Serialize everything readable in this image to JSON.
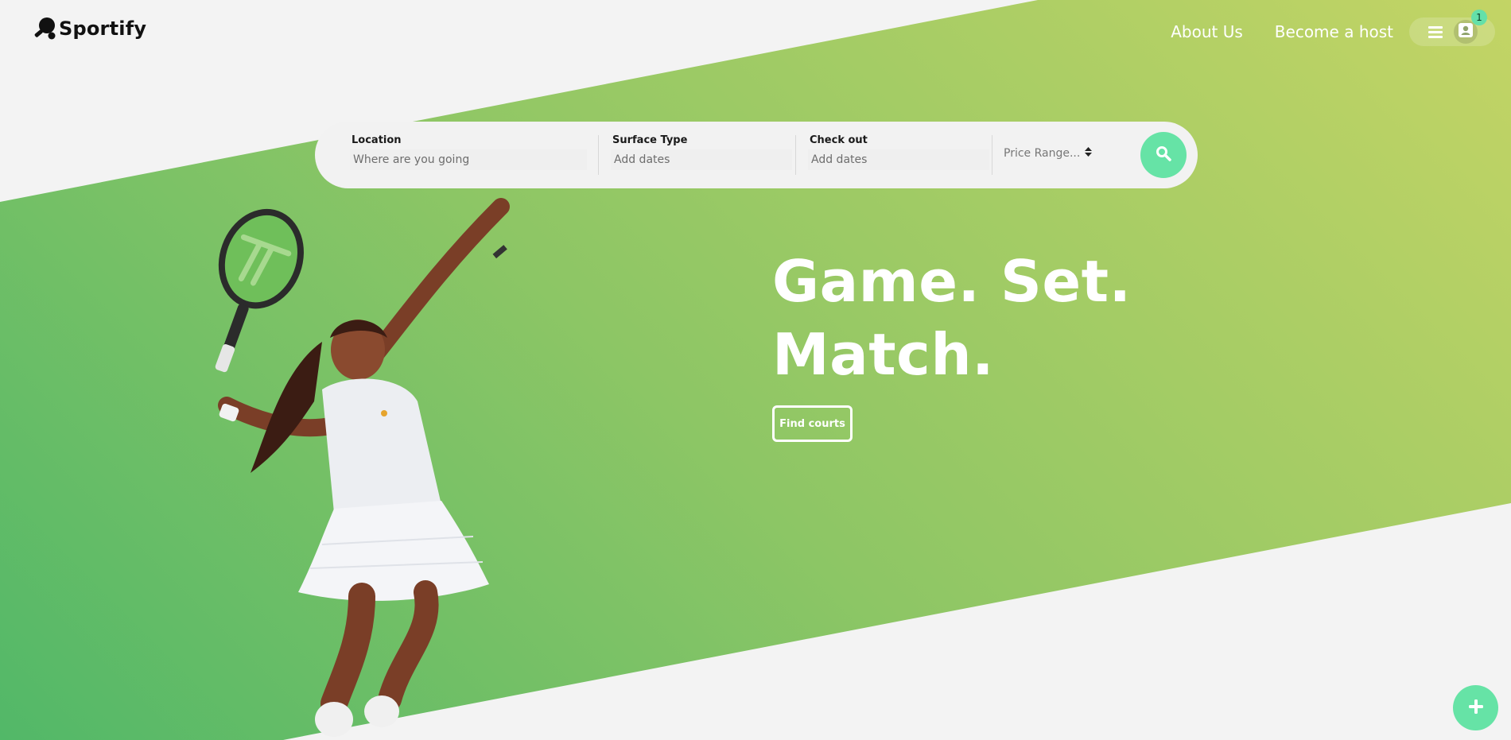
{
  "app": {
    "brand": "Sportify",
    "logo_icon": "ping-pong-paddle-icon"
  },
  "header": {
    "nav": {
      "about": "About Us",
      "host": "Become a host"
    },
    "user_menu": {
      "menu_icon": "hamburger-menu-icon",
      "avatar_icon": "user-contact-icon",
      "notification_count": "1"
    }
  },
  "search": {
    "location": {
      "label": "Location",
      "placeholder": "Where are you going"
    },
    "surface": {
      "label": "Surface Type",
      "placeholder": "Add dates"
    },
    "checkout": {
      "label": "Check out",
      "placeholder": "Add dates"
    },
    "price": {
      "selected": "Price Range..."
    },
    "button_icon": "search-icon"
  },
  "hero": {
    "headline_line1": "Game. Set.",
    "headline_line2": "Match.",
    "cta": "Find courts",
    "image": "tennis-player-serving"
  },
  "fab": {
    "icon": "plus-icon"
  },
  "colors": {
    "accent": "#66e3a6",
    "gradient_start": "#52b868",
    "gradient_end": "#c3d465",
    "background": "#f3f3f3"
  }
}
